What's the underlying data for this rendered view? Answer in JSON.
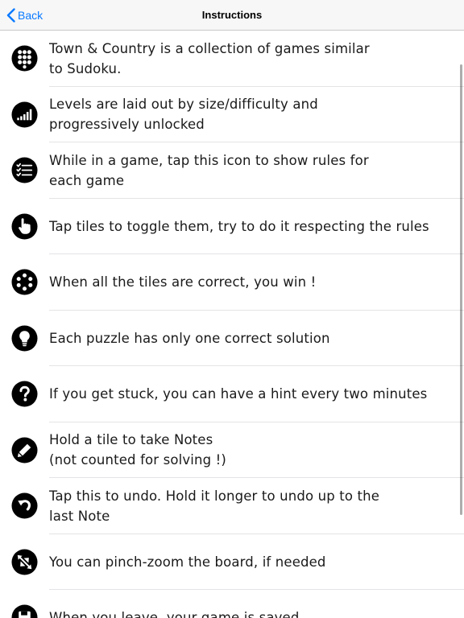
{
  "navbar": {
    "back_label": "Back",
    "title": "Instructions",
    "accent_color": "#0a7aff"
  },
  "items": [
    {
      "icon": "grid-dots-icon",
      "text": "Town & Country is a collection of games similar\nto Sudoku."
    },
    {
      "icon": "levels-bars-icon",
      "text": "Levels are laid out by size/difficulty and\nprogressively unlocked"
    },
    {
      "icon": "rules-list-icon",
      "text": "While in a game, tap this icon to show rules for\neach game"
    },
    {
      "icon": "tap-hand-icon",
      "text": "Tap tiles to toggle them, try to do it respecting the rules"
    },
    {
      "icon": "ring-dots-icon",
      "text": "When all the tiles are correct, you win !"
    },
    {
      "icon": "lightbulb-icon",
      "text": "Each puzzle has only one correct solution"
    },
    {
      "icon": "question-icon",
      "text": "If you get stuck, you can have a hint every two minutes"
    },
    {
      "icon": "pencil-icon",
      "text": "Hold a tile to take Notes\n(not counted for solving !)"
    },
    {
      "icon": "undo-icon",
      "text": "Tap this to undo. Hold it longer to undo up to the\nlast Note"
    },
    {
      "icon": "pinch-zoom-icon",
      "text": "You can pinch-zoom the board, if needed"
    },
    {
      "icon": "save-icon",
      "text": "When you leave, your game is saved"
    }
  ]
}
